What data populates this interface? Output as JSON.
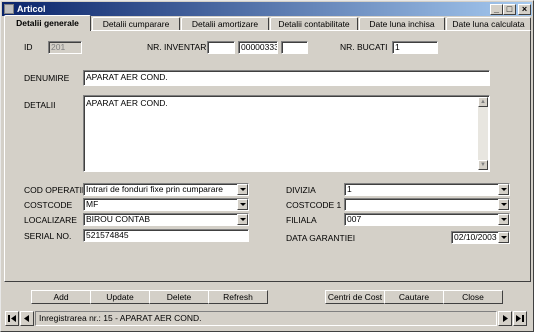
{
  "window": {
    "title": "Articol"
  },
  "tabs": [
    {
      "label": "Detalii generale",
      "active": true
    },
    {
      "label": "Detalii cumparare"
    },
    {
      "label": "Detalii amortizare"
    },
    {
      "label": "Detalii contabilitate"
    },
    {
      "label": "Date luna inchisa"
    },
    {
      "label": "Date luna calculata"
    }
  ],
  "form": {
    "id_label": "ID",
    "id_value": "201",
    "nr_inventar_label": "NR. INVENTAR",
    "nr_inventar_prefix": "",
    "nr_inventar_value": "00000333",
    "nr_inventar_suffix": "",
    "nr_bucati_label": "NR. BUCATI",
    "nr_bucati_value": "1",
    "denumire_label": "DENUMIRE",
    "denumire_value": "APARAT AER COND.",
    "detalii_label": "DETALII",
    "detalii_value": "APARAT AER COND.",
    "cod_operatie_label": "COD OPERATIE",
    "cod_operatie_value": "Intrari de fonduri fixe prin cumparare",
    "costcode_label": "COSTCODE",
    "costcode_value": "MF",
    "localizare_label": "LOCALIZARE",
    "localizare_value": "BIROU CONTAB",
    "serial_label": "SERIAL NO.",
    "serial_value": "521574845",
    "divizia_label": "DIVIZIA",
    "divizia_value": "1",
    "costcode1_label": "COSTCODE 1",
    "costcode1_value": "",
    "filiala_label": "FILIALA",
    "filiala_value": "007",
    "data_garantiei_label": "DATA GARANTIEI",
    "data_garantiei_value": "02/10/2003"
  },
  "buttons": {
    "add": "Add",
    "update": "Update",
    "delete": "Delete",
    "refresh": "Refresh",
    "centri_de_cost": "Centri de Cost",
    "cautare": "Cautare",
    "close": "Close"
  },
  "navigator": {
    "status": "Inregistrarea nr.: 15 - APARAT AER COND."
  }
}
